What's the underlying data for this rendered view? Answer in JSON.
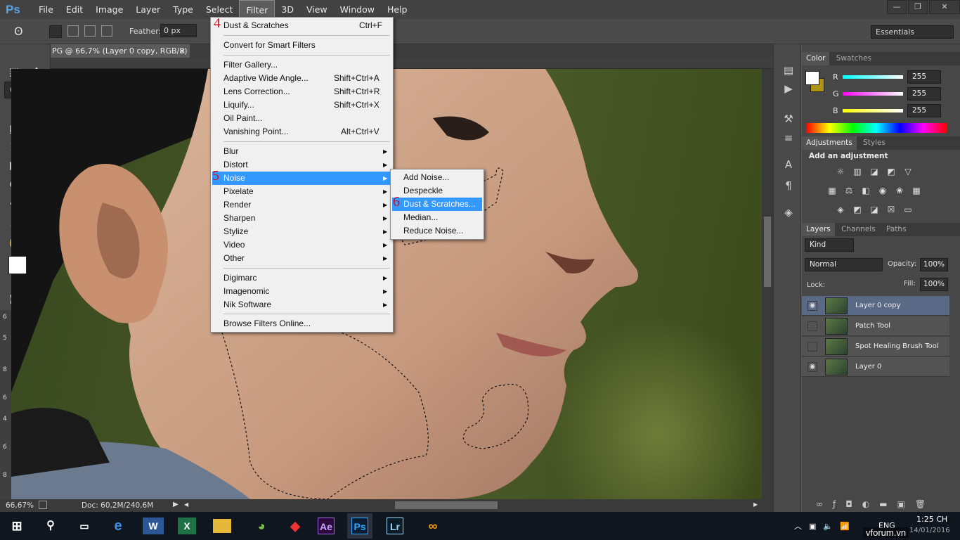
{
  "app": {
    "logo": "Ps"
  },
  "menubar": [
    "File",
    "Edit",
    "Image",
    "Layer",
    "Type",
    "Select",
    "Filter",
    "3D",
    "View",
    "Window",
    "Help"
  ],
  "window_controls": {
    "minimize": "—",
    "restore": "❐",
    "close": "✕"
  },
  "options": {
    "feather_label": "Feather:",
    "feather_value": "0 px",
    "workspace": "Essentials"
  },
  "document": {
    "tab_title": "PG @ 66,7% (Layer 0 copy, RGB/8) *",
    "close": "×"
  },
  "ruler_v_ticks": [
    "6",
    "5",
    "8",
    "6",
    "4",
    "6",
    "8"
  ],
  "status": {
    "zoom": "66,67%",
    "doc": "Doc: 60,2M/240,6M"
  },
  "filter_menu": {
    "items": [
      {
        "label": "Dust & Scratches",
        "shortcut": "Ctrl+F",
        "step": "4"
      },
      {
        "label": "Convert for Smart Filters"
      },
      {
        "label": "Filter Gallery..."
      },
      {
        "label": "Adaptive Wide Angle...",
        "shortcut": "Shift+Ctrl+A"
      },
      {
        "label": "Lens Correction...",
        "shortcut": "Shift+Ctrl+R"
      },
      {
        "label": "Liquify...",
        "shortcut": "Shift+Ctrl+X"
      },
      {
        "label": "Oil Paint..."
      },
      {
        "label": "Vanishing Point...",
        "shortcut": "Alt+Ctrl+V"
      },
      {
        "label": "Blur"
      },
      {
        "label": "Distort"
      },
      {
        "label": "Noise",
        "step": "5"
      },
      {
        "label": "Pixelate"
      },
      {
        "label": "Render"
      },
      {
        "label": "Sharpen"
      },
      {
        "label": "Stylize"
      },
      {
        "label": "Video"
      },
      {
        "label": "Other"
      },
      {
        "label": "Digimarc"
      },
      {
        "label": "Imagenomic"
      },
      {
        "label": "Nik Software"
      },
      {
        "label": "Browse Filters Online..."
      }
    ]
  },
  "noise_submenu": {
    "items": [
      {
        "label": "Add Noise..."
      },
      {
        "label": "Despeckle"
      },
      {
        "label": "Dust & Scratches...",
        "step": "6"
      },
      {
        "label": "Median..."
      },
      {
        "label": "Reduce Noise..."
      }
    ]
  },
  "color_panel": {
    "tabs": [
      "Color",
      "Swatches"
    ],
    "r_label": "R",
    "r": "255",
    "g_label": "G",
    "g": "255",
    "b_label": "B",
    "b": "255",
    "fg": "#ffffff",
    "bg": "#b09312"
  },
  "adjustments_panel": {
    "tabs": [
      "Adjustments",
      "Styles"
    ],
    "heading": "Add an adjustment"
  },
  "layers_panel": {
    "tabs": [
      "Layers",
      "Channels",
      "Paths"
    ],
    "kind": "Kind",
    "blend": "Normal",
    "opacity_label": "Opacity:",
    "opacity": "100%",
    "lock_label": "Lock:",
    "fill_label": "Fill:",
    "fill": "100%",
    "layers": [
      {
        "name": "Layer 0 copy",
        "visible": true,
        "selected": true
      },
      {
        "name": "Patch Tool",
        "visible": false
      },
      {
        "name": "Spot Healing Brush Tool",
        "visible": false
      },
      {
        "name": "Layer 0",
        "visible": true
      }
    ]
  },
  "taskbar": {
    "apps": [
      "Ae",
      "Ps",
      "Lr"
    ],
    "lang": "ENG",
    "time": "1:25 CH",
    "date": "14/01/2016",
    "watermark": "vforum.vn"
  },
  "colors": {
    "menu_highlight": "#3399ff",
    "step_numbers": "#d0101a"
  }
}
